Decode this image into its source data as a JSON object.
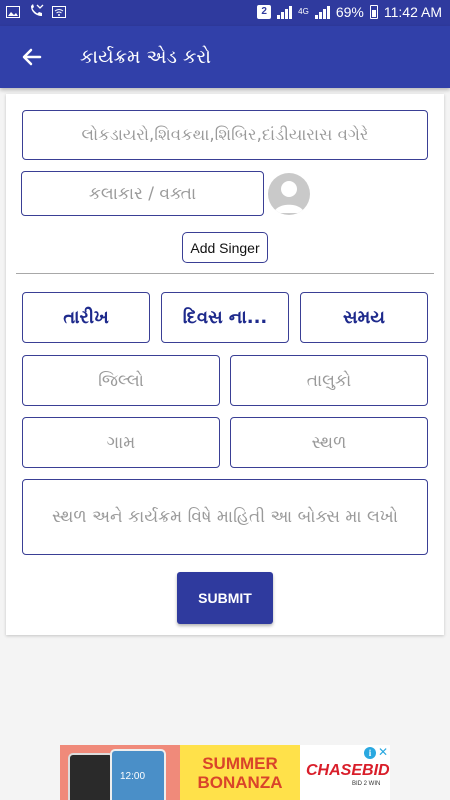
{
  "status_bar": {
    "sim_badge": "2",
    "network_type": "4G",
    "battery": "69%",
    "time": "11:42 AM"
  },
  "toolbar": {
    "title": "કાર્યક્રમ એડ કરો"
  },
  "form": {
    "program_type_placeholder": "લોકડાયરો,શિવકથા,શિબિર,દાંડીયારાસ વગેરે",
    "artist_placeholder": "કલાકાર / વક્તા",
    "add_singer_label": "Add Singer",
    "date_label": "તારીખ",
    "day_label": "દિવસ ના...",
    "time_label": "સમય",
    "district_placeholder": "જિલ્લો",
    "taluka_placeholder": "તાલુકો",
    "village_placeholder": "ગામ",
    "place_placeholder": "સ્થળ",
    "details_placeholder": "સ્થળ અને કાર્યક્રમ વિષે માહિતી આ બોક્સ મા લખો",
    "submit_label": "SUBMIT"
  },
  "ad": {
    "headline_line1": "SUMMER",
    "headline_line2": "BONANZA",
    "brand": "CHASEBID",
    "tagline": "BID 2 WIN",
    "phone_clock": "12:00"
  },
  "colors": {
    "primary": "#3140a9",
    "status_bar": "#2f3a9e",
    "field_border": "#3a3f95",
    "button_text": "#1e2a8c"
  }
}
